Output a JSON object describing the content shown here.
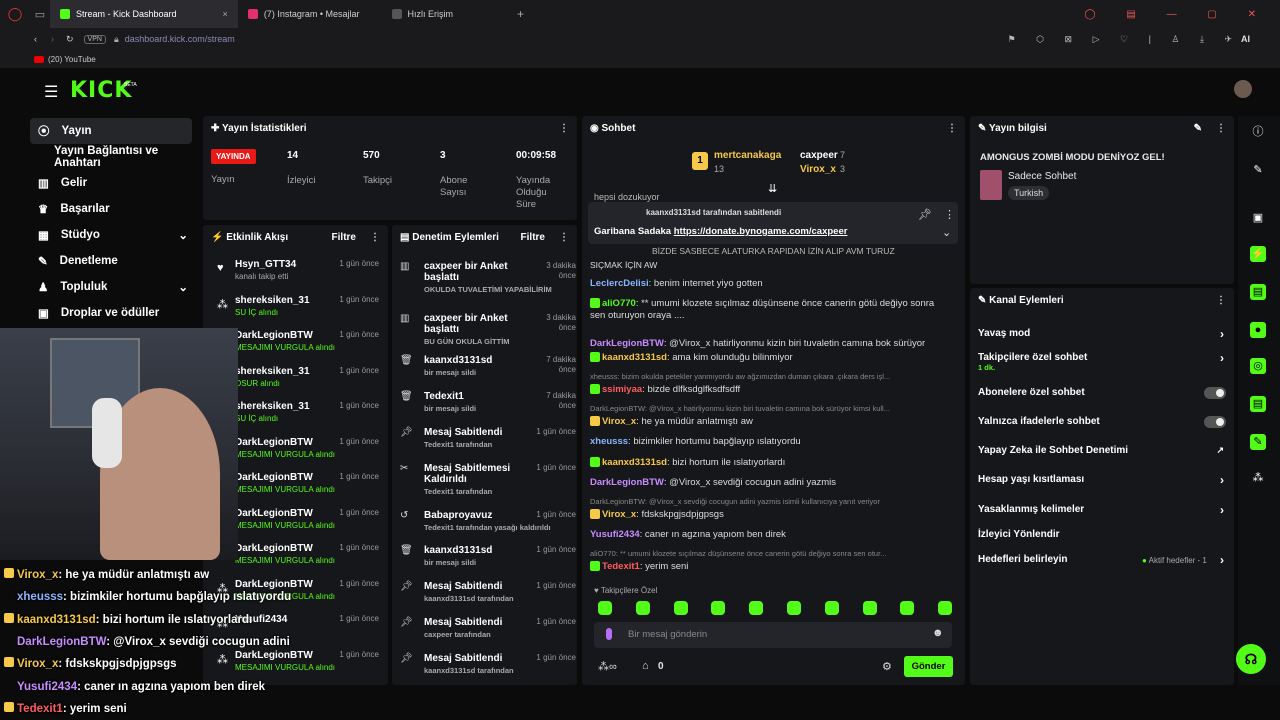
{
  "browser": {
    "tabs": [
      {
        "label": "Stream - Kick Dashboard",
        "color": "#53fc18"
      },
      {
        "label": "(7) Instagram • Mesajlar",
        "color": "#e1306c"
      },
      {
        "label": "Hızlı Erişim",
        "color": "#888888"
      }
    ],
    "url_host": "dashboard.kick.com",
    "url_path": "/stream",
    "vpn": "VPN",
    "bookmark": "(20) YouTube",
    "ai_label": "AI"
  },
  "logo": "KICK",
  "logo_sup": "BETA",
  "nav": {
    "items": [
      {
        "label": "Yayın",
        "icon": "broadcast-icon"
      },
      {
        "label": "Yayın Bağlantısı ve Anahtarı",
        "icon": ""
      },
      {
        "label": "Gelir",
        "icon": "chart-icon"
      },
      {
        "label": "Başarılar",
        "icon": "trophy-icon"
      },
      {
        "label": "Stüdyo",
        "icon": "studio-icon"
      },
      {
        "label": "Denetleme",
        "icon": "wrench-icon"
      },
      {
        "label": "Topluluk",
        "icon": "people-icon"
      },
      {
        "label": "Droplar ve ödüller",
        "icon": "gift-icon"
      }
    ]
  },
  "stats": {
    "title": "Yayın İstatistikleri",
    "live": "YAYINDA",
    "live_label": "Yayın",
    "items": [
      {
        "value": "14",
        "label": "İzleyici"
      },
      {
        "value": "570",
        "label": "Takipçi"
      },
      {
        "value": "3",
        "label": "Abone Sayısı"
      },
      {
        "value": "00:09:58",
        "label": "Yayında Olduğu Süre"
      }
    ]
  },
  "activity": {
    "title": "Etkinlik Akışı",
    "filter": "Filtre",
    "events": [
      {
        "name": "Hsyn_GTT34",
        "sub": "kanalı takip etti",
        "time": "1 gün önce"
      },
      {
        "name": "shereksiken_31",
        "sub": "SU İÇ alındı",
        "time": "1 gün önce"
      },
      {
        "name": "DarkLegionBTW",
        "sub": "MESAJIMI VURGULA alındı",
        "time": "1 gün önce"
      },
      {
        "name": "shereksiken_31",
        "sub": "OSUR alındı",
        "time": "1 gün önce"
      },
      {
        "name": "shereksiken_31",
        "sub": "SU İÇ alındı",
        "time": "1 gün önce"
      },
      {
        "name": "DarkLegionBTW",
        "sub": "MESAJIMI VURGULA alındı",
        "time": "1 gün önce"
      },
      {
        "name": "DarkLegionBTW",
        "sub": "MESAJIMI VURGULA alındı",
        "time": "1 gün önce"
      },
      {
        "name": "DarkLegionBTW",
        "sub": "MESAJIMI VURGULA alındı",
        "time": "1 gün önce"
      },
      {
        "name": "DarkLegionBTW",
        "sub": "MESAJIMI VURGULA alındı",
        "time": "1 gün önce"
      },
      {
        "name": "DarkLegionBTW",
        "sub": "MESAJIMI VURGULA alındı",
        "time": "1 gün önce"
      },
      {
        "name": "Yusufi2434",
        "sub": "",
        "time": "1 gün önce"
      },
      {
        "name": "DarkLegionBTW",
        "sub": "MESAJIMI VURGULA alındı",
        "time": "1 gün önce"
      }
    ]
  },
  "moderation": {
    "title": "Denetim Eylemleri",
    "filter": "Filtre",
    "items": [
      {
        "title": "caxpeer bir Anket başlattı",
        "sub": "OKULDA TUVALETİMİ YAPABİLİRİM",
        "time": "3 dakika önce"
      },
      {
        "title": "caxpeer bir Anket başlattı",
        "sub": "BU GÜN OKULA GİTTİM",
        "time": "3 dakika önce"
      },
      {
        "title": "kaanxd3131sd",
        "sub": "bir mesajı sildi",
        "time": "7 dakika önce"
      },
      {
        "title": "Tedexit1",
        "sub": "bir mesajı sildi",
        "time": "7 dakika önce"
      },
      {
        "title": "Mesaj Sabitlendi",
        "sub": "Tedexit1 tarafından",
        "time": "1 gün önce"
      },
      {
        "title": "Mesaj Sabitlemesi Kaldırıldı",
        "sub": "Tedexit1 tarafından",
        "time": "1 gün önce"
      },
      {
        "title": "Babaproyavuz",
        "sub": "Tedexit1 tarafından yasağı kaldırıldı",
        "time": "1 gün önce"
      },
      {
        "title": "kaanxd3131sd",
        "sub": "bir mesajı sildi",
        "time": "1 gün önce"
      },
      {
        "title": "Mesaj Sabitlendi",
        "sub": "kaanxd3131sd tarafından",
        "time": "1 gün önce"
      },
      {
        "title": "Mesaj Sabitlendi",
        "sub": "caxpeer tarafından",
        "time": "1 gün önce"
      },
      {
        "title": "Mesaj Sabitlendi",
        "sub": "kaanxd3131sd tarafından",
        "time": "1 gün önce"
      }
    ]
  },
  "chat": {
    "title": "Sohbet",
    "leaders": [
      {
        "name": "mertcanakaga",
        "count": "13"
      },
      {
        "name": "caxpeer",
        "count": "7"
      },
      {
        "name": "Virox_x",
        "count": "3"
      }
    ],
    "pinned_by": "kaanxd3131sd tarafından sabitlendi",
    "pinned_text": "Garibana Sadaka",
    "pinned_link": "https://donate.bynogame.com/caxpeer",
    "top_clip": "hepsi dozukuyor",
    "clip2": "BİZDE SASBECE ALATURKA RAPIDAN İZİN ALIP AVM TURUZ",
    "clip3": "SIÇMAK İÇİN AW",
    "messages": [
      {
        "user": "LeclercDelisi",
        "color": "#8ab4ff",
        "text": "benim internet yiyo gotten"
      },
      {
        "user": "aliO770",
        "color": "#53fc18",
        "text": "** umumi klozete sıçılmaz düşünsene önce canerin götü değiyo sonra sen oturuyon oraya ...."
      },
      {
        "user": "DarkLegionBTW",
        "color": "#c88cff",
        "text": "@Virox_x hatirliyonmu kizin biri tuvaletin camına bok sürüyor"
      },
      {
        "user": "kaanxd3131sd",
        "color": "#f7c948",
        "text": "ama kim olunduğu bilinmiyor"
      },
      {
        "user": "",
        "color": "#888",
        "text": "xheusss: bizim okulda petekler yanmıyordu aw ağzımızdan duman çıkara .çıkara ders işl..."
      },
      {
        "user": "ssimiyaa",
        "color": "#ff5c5c",
        "text": "bizde dlfksdglfksdfsdff"
      },
      {
        "user": "",
        "color": "#888",
        "text": "DarkLegionBTW: @Virox_x hatirliyonmu kizin biri tuvaletin camına bok sürüyor kimsi kull..."
      },
      {
        "user": "Virox_x",
        "color": "#f7c948",
        "text": "he ya müdür anlatmıştı aw"
      },
      {
        "user": "xheusss",
        "color": "#8ab4ff",
        "text": "bizimkiler hortumu bapğlayıp ıslatıyordu"
      },
      {
        "user": "kaanxd3131sd",
        "color": "#f7c948",
        "text": "bizi hortum ile ıslatıyorlardı"
      },
      {
        "user": "DarkLegionBTW",
        "color": "#c88cff",
        "text": "@Virox_x sevdiği cocugun adini yazmis"
      },
      {
        "user": "",
        "color": "#888",
        "text": "DarkLegionBTW: @Virox_x sevdiği cocugun adini yazmis isimli kullanıcıya yanıt veriyor"
      },
      {
        "user": "Virox_x",
        "color": "#f7c948",
        "text": "fdskskpgjsdpjgpsgs"
      },
      {
        "user": "Yusufi2434",
        "color": "#c88cff",
        "text": "caner ın agzına yapıom ben direk"
      },
      {
        "user": "",
        "color": "#888",
        "text": "aliO770: ** umumi klozete sıçılmaz düşünsene önce canerin götü değiyo sonra sen otur..."
      },
      {
        "user": "Tedexit1",
        "color": "#ff5c5c",
        "text": "yerim seni"
      }
    ],
    "followers_only": "Takipçilere Özel",
    "input_placeholder": "Bir mesaj gönderin",
    "points": "0",
    "send": "Gönder"
  },
  "stream_info": {
    "title": "Yayın bilgisi",
    "stream_title": "AMONGUS ZOMBİ MODU DENİYOZ GEL!",
    "category": "Sadece Sohbet",
    "tag": "Turkish"
  },
  "channel_actions": {
    "title": "Kanal Eylemleri",
    "items": [
      {
        "label": "Yavaş mod",
        "sub": "",
        "control": "chevron"
      },
      {
        "label": "Takipçilere özel sohbet",
        "sub": "1 dk.",
        "control": "chevron"
      },
      {
        "label": "Abonelere özel sohbet",
        "sub": "",
        "control": "toggle"
      },
      {
        "label": "Yalnızca ifadelerle sohbet",
        "sub": "",
        "control": "toggle"
      },
      {
        "label": "Yapay Zeka ile Sohbet Denetimi",
        "sub": "",
        "control": "external"
      },
      {
        "label": "Hesap yaşı kısıtlaması",
        "sub": "",
        "control": "chevron"
      },
      {
        "label": "Yasaklanmış kelimeler",
        "sub": "",
        "control": "chevron"
      },
      {
        "label": "İzleyici Yönlendir",
        "sub": "",
        "control": "none"
      },
      {
        "label": "Hedefleri belirleyin",
        "sub": "",
        "control": "chevron"
      }
    ],
    "goals_status": "Aktif hedefler - 1"
  },
  "overlay_chat": [
    {
      "user": "Virox_x",
      "text": ": he ya müdür anlatmıştı aw",
      "color": "#f7c948"
    },
    {
      "user": "xheusss",
      "text": ": bizimkiler hortumu bapğlayıp ıslatıyordu",
      "color": "#8ab4ff"
    },
    {
      "user": "kaanxd3131sd",
      "text": ": bizi hortum ile ıslatıyorlardı",
      "color": "#f7c948"
    },
    {
      "user": "DarkLegionBTW",
      "text": ": @Virox_x sevdiği cocugun adini",
      "color": "#c88cff"
    },
    {
      "user": "Virox_x",
      "text": ": fdskskpgjsdpjgpsgs",
      "color": "#f7c948"
    },
    {
      "user": "Yusufi2434",
      "text": ": caner ın agzına yapıom ben direk",
      "color": "#c88cff"
    },
    {
      "user": "Tedexit1",
      "text": ": yerim seni",
      "color": "#ff5c5c"
    }
  ],
  "colors": {
    "accent": "#53fc18",
    "live": "#e91916",
    "panel": "#16171a"
  }
}
